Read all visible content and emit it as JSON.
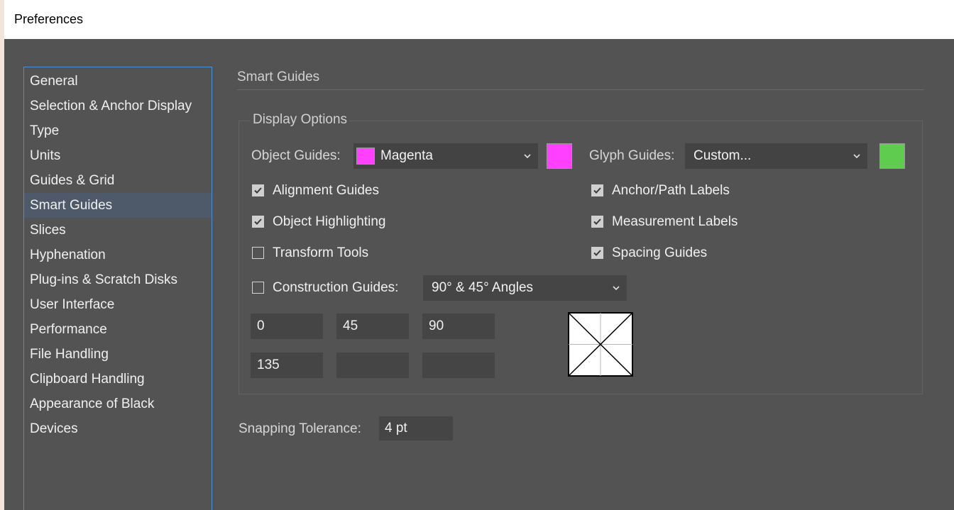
{
  "window": {
    "title": "Preferences"
  },
  "sidebar": {
    "items": [
      {
        "label": "General"
      },
      {
        "label": "Selection & Anchor Display"
      },
      {
        "label": "Type"
      },
      {
        "label": "Units"
      },
      {
        "label": "Guides & Grid"
      },
      {
        "label": "Smart Guides",
        "selected": true
      },
      {
        "label": "Slices"
      },
      {
        "label": "Hyphenation"
      },
      {
        "label": "Plug-ins & Scratch Disks"
      },
      {
        "label": "User Interface"
      },
      {
        "label": "Performance"
      },
      {
        "label": "File Handling"
      },
      {
        "label": "Clipboard Handling"
      },
      {
        "label": "Appearance of Black"
      },
      {
        "label": "Devices"
      }
    ]
  },
  "main": {
    "section_title": "Smart Guides",
    "display_options": {
      "group_label": "Display Options",
      "object_guides": {
        "label": "Object Guides:",
        "value": "Magenta",
        "color": "#ff40ff"
      },
      "glyph_guides": {
        "label": "Glyph Guides:",
        "value": "Custom...",
        "color": "#5fcc4f"
      },
      "checkboxes": {
        "alignment_guides": {
          "label": "Alignment Guides",
          "checked": true
        },
        "object_highlighting": {
          "label": "Object Highlighting",
          "checked": true
        },
        "transform_tools": {
          "label": "Transform Tools",
          "checked": false
        },
        "anchor_path_labels": {
          "label": "Anchor/Path Labels",
          "checked": true
        },
        "measurement_labels": {
          "label": "Measurement Labels",
          "checked": true
        },
        "spacing_guides": {
          "label": "Spacing Guides",
          "checked": true
        }
      },
      "construction_guides": {
        "label": "Construction Guides:",
        "checked": false,
        "value": "90° & 45° Angles",
        "angles": [
          "0",
          "45",
          "90",
          "135",
          "",
          ""
        ]
      }
    },
    "snapping_tolerance": {
      "label": "Snapping Tolerance:",
      "value": "4 pt"
    }
  },
  "icons": {
    "dropdown": "chevron-down-icon",
    "checkbox": "checkmark-icon"
  },
  "colors": {
    "panel_bg": "#535353",
    "field_bg": "#434343",
    "sidebar_border": "#4a90d9",
    "selected_bg": "#4e5a6a"
  }
}
